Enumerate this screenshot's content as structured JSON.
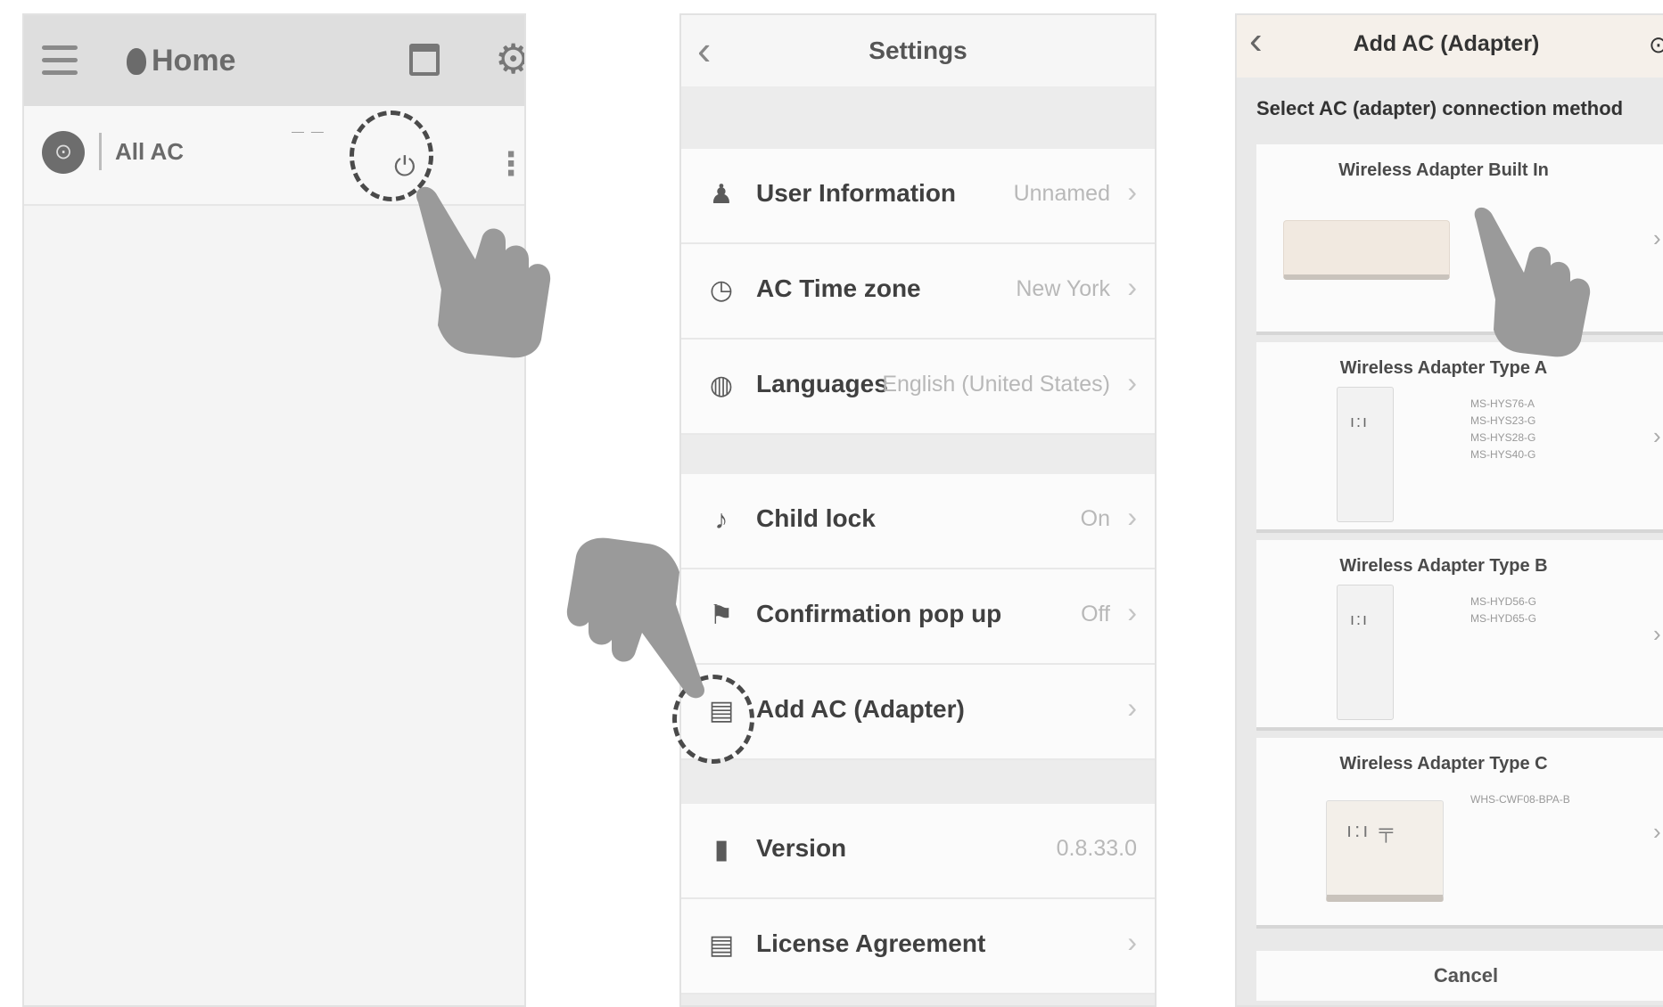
{
  "home": {
    "title": "Home",
    "ac_item": {
      "avatar": "⊙",
      "name": "All AC",
      "temp": "— —",
      "power_icon": "⏻",
      "more_icon": "⋮"
    }
  },
  "settings": {
    "title": "Settings",
    "back": "‹",
    "rows": [
      {
        "icon": "person-icon",
        "glyph": "♟",
        "label": "User Information",
        "value": "Unnamed",
        "chevron": "›"
      },
      {
        "icon": "clock-icon",
        "glyph": "◷",
        "label": "AC Time zone",
        "value": "New York",
        "chevron": "›"
      },
      {
        "icon": "globe-icon",
        "glyph": "◍",
        "label": "Languages",
        "value": "English (United States)",
        "chevron": "›"
      },
      {
        "icon": "bell-icon",
        "glyph": "♪",
        "label": "Child lock",
        "value": "On",
        "chevron": "›"
      },
      {
        "icon": "flag-icon",
        "glyph": "⚑",
        "label": "Confirmation pop up",
        "value": "Off",
        "chevron": "›"
      },
      {
        "icon": "adapter-icon",
        "glyph": "▤",
        "label": "Add AC (Adapter)",
        "value": "",
        "chevron": "›"
      },
      {
        "icon": "version-icon",
        "glyph": "▮",
        "label": "Version",
        "value": "0.8.33.0",
        "chevron": ""
      },
      {
        "icon": "document-icon",
        "glyph": "▤",
        "label": "License Agreement",
        "value": "",
        "chevron": "›"
      }
    ]
  },
  "add_ac": {
    "title": "Add AC (Adapter)",
    "back": "‹",
    "right_icon": "⊙",
    "subtitle": "Select AC (adapter) connection method",
    "cards": [
      {
        "title": "Wireless Adapter Built In",
        "models": [],
        "chevron": "›"
      },
      {
        "title": "Wireless Adapter Type A",
        "models": [
          "MS-HYS76-A",
          "MS-HYS23-G",
          "MS-HYS28-G",
          "MS-HYS40-G"
        ],
        "chevron": "›"
      },
      {
        "title": "Wireless Adapter Type B",
        "models": [
          "MS-HYD56-G",
          "MS-HYD65-G"
        ],
        "chevron": "›"
      },
      {
        "title": "Wireless Adapter Type C",
        "models": [
          "WHS-CWF08-BPA-B"
        ],
        "chevron": "›"
      }
    ],
    "cancel_label": "Cancel"
  }
}
